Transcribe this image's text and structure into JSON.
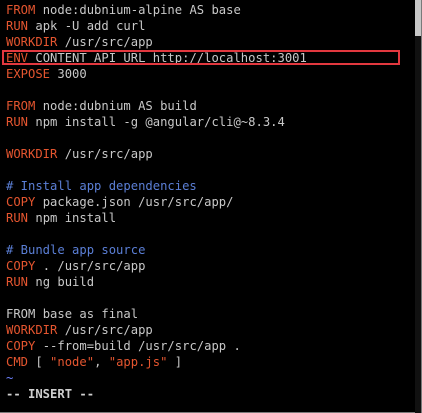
{
  "lines": [
    [
      {
        "t": "FROM",
        "c": "kw"
      },
      {
        "t": " node:dubnium-alpine AS base",
        "c": "txt"
      }
    ],
    [
      {
        "t": "RUN",
        "c": "kw"
      },
      {
        "t": " apk -U add curl",
        "c": "txt"
      }
    ],
    [
      {
        "t": "WORKDIR",
        "c": "kw"
      },
      {
        "t": " /usr/src/app",
        "c": "txt"
      }
    ],
    [
      {
        "t": "ENV",
        "c": "kw"
      },
      {
        "t": " CONTENT_API_URL http://localhost:3001",
        "c": "txt"
      }
    ],
    [
      {
        "t": "EXPOSE",
        "c": "kw"
      },
      {
        "t": " 3000",
        "c": "txt"
      }
    ],
    [],
    [
      {
        "t": "FROM",
        "c": "kw"
      },
      {
        "t": " node:dubnium AS build",
        "c": "txt"
      }
    ],
    [
      {
        "t": "RUN",
        "c": "kw"
      },
      {
        "t": " npm install -g @angular/cli@~8.3.4",
        "c": "txt"
      }
    ],
    [],
    [
      {
        "t": "WORKDIR",
        "c": "kw"
      },
      {
        "t": " /usr/src/app",
        "c": "txt"
      }
    ],
    [],
    [
      {
        "t": "# Install app dependencies",
        "c": "cmt"
      }
    ],
    [
      {
        "t": "COPY",
        "c": "kw"
      },
      {
        "t": " package.json /usr/src/app/",
        "c": "txt"
      }
    ],
    [
      {
        "t": "RUN",
        "c": "kw"
      },
      {
        "t": " npm install",
        "c": "txt"
      }
    ],
    [],
    [
      {
        "t": "# Bundle app source",
        "c": "cmt"
      }
    ],
    [
      {
        "t": "COPY",
        "c": "kw"
      },
      {
        "t": " . /usr/src/app",
        "c": "txt"
      }
    ],
    [
      {
        "t": "RUN",
        "c": "kw"
      },
      {
        "t": " ng build",
        "c": "txt"
      }
    ],
    [],
    [
      {
        "t": "FROM",
        "c": "txt"
      },
      {
        "t": " base as final",
        "c": "txt"
      }
    ],
    [
      {
        "t": "WORKDIR",
        "c": "kw"
      },
      {
        "t": " /usr/src/app",
        "c": "txt"
      }
    ],
    [
      {
        "t": "COPY",
        "c": "kw"
      },
      {
        "t": " --from=build /usr/src/app .",
        "c": "txt"
      }
    ],
    [
      {
        "t": "CMD",
        "c": "kw"
      },
      {
        "t": " [ ",
        "c": "txt"
      },
      {
        "t": "\"node\"",
        "c": "str"
      },
      {
        "t": ", ",
        "c": "txt"
      },
      {
        "t": "\"app.js\"",
        "c": "str"
      },
      {
        "t": " ]",
        "c": "txt"
      }
    ],
    [
      {
        "t": "~",
        "c": "tilde"
      }
    ],
    [
      {
        "t": "-- INSERT --",
        "c": "insert"
      }
    ]
  ],
  "colors": {
    "background": "#000000",
    "keyword": "#e4552f",
    "text": "#c8c8c8",
    "comment": "#5b7fd6",
    "highlight_border": "#e2383f"
  }
}
